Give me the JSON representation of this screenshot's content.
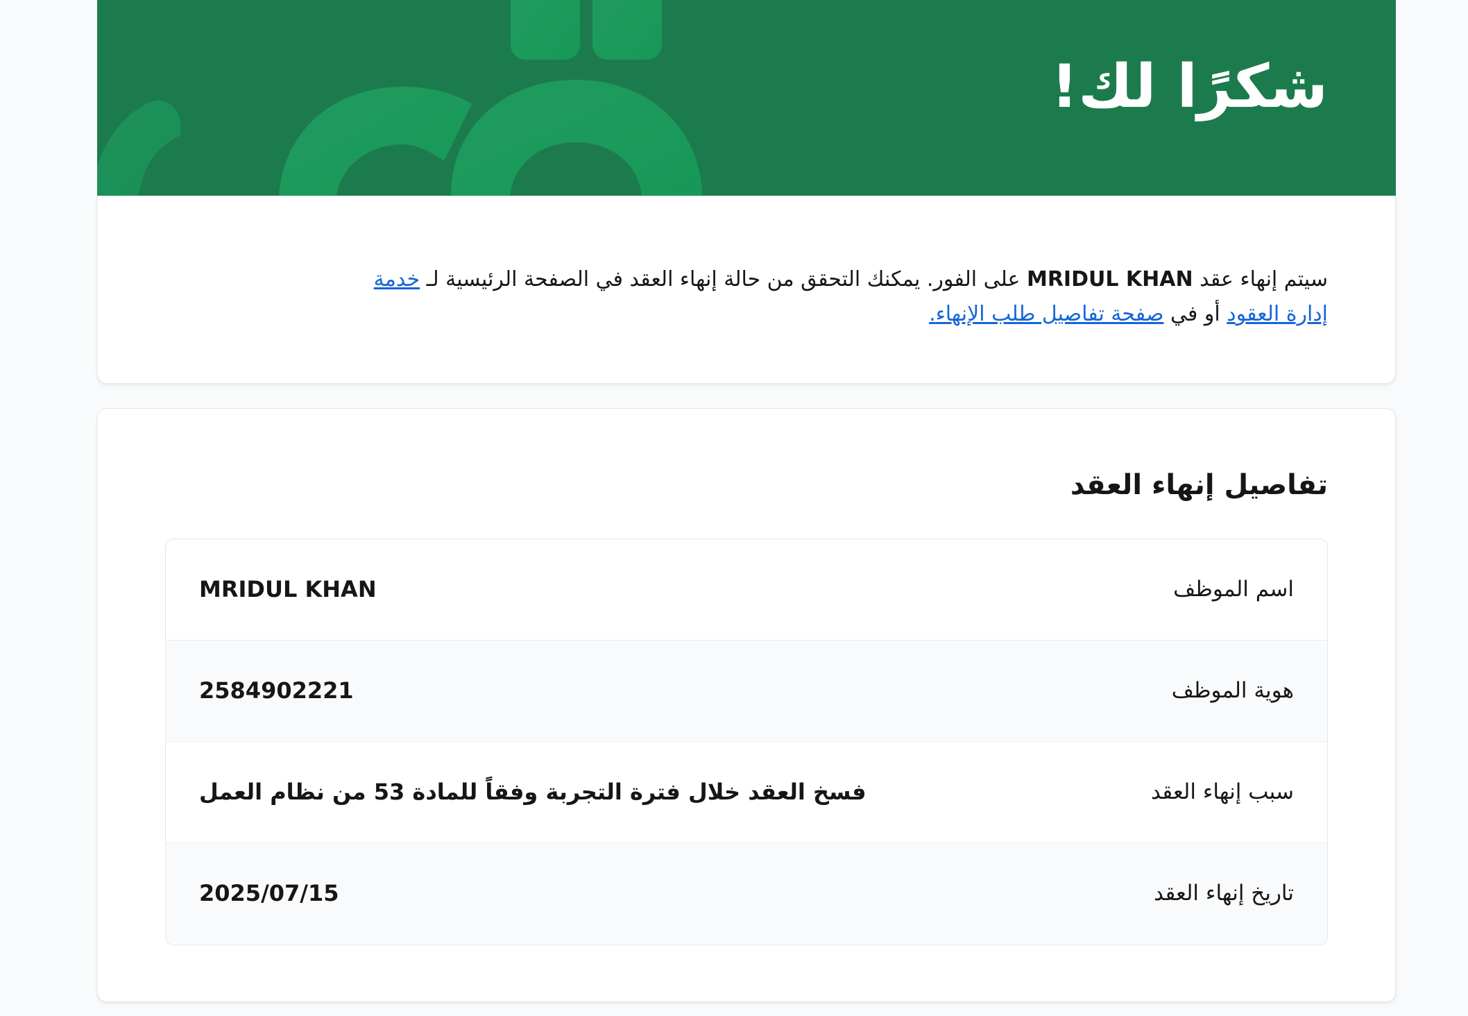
{
  "header": {
    "title": "شكرًا لك!",
    "background_color": "#1c7b4d",
    "decoration": "brand-letter-shapes"
  },
  "message": {
    "prefix": "سيتم إنهاء عقد ",
    "employee_name": "MRIDUL KHAN",
    "middle": " على الفور. يمكنك التحقق من حالة إنهاء العقد في الصفحة الرئيسية لـ ",
    "link_contracts": "خدمة إدارة العقود",
    "or_text": " أو في ",
    "link_details": "صفحة تفاصيل طلب الإنهاء",
    "suffix": ".",
    "link_color": "#1565d8"
  },
  "details": {
    "title": "تفاصيل إنهاء العقد",
    "rows": [
      {
        "label": "اسم الموظف",
        "value": "MRIDUL KHAN"
      },
      {
        "label": "هوية الموظف",
        "value": "2584902221"
      },
      {
        "label": "سبب إنهاء العقد",
        "value": "فسخ العقد خلال فترة التجربة وفقاً للمادة 53 من نظام العمل"
      },
      {
        "label": "تاريخ إنهاء العقد",
        "value": "2025/07/15"
      }
    ]
  }
}
